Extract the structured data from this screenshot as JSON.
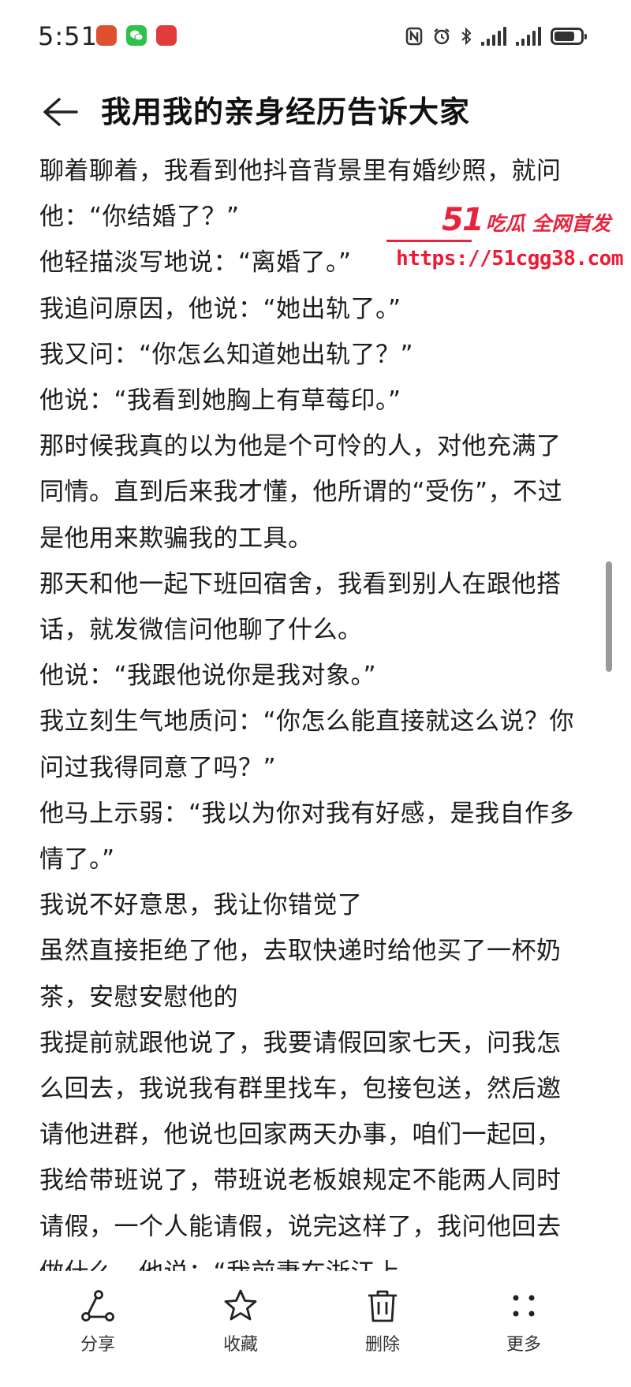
{
  "status_bar": {
    "time": "5:51",
    "apps": [
      {
        "name": "app-icon-1",
        "label": "",
        "color": "#e0502f"
      },
      {
        "name": "wechat-icon",
        "label": "",
        "color": "#2dc24a"
      },
      {
        "name": "app-icon-3",
        "label": "",
        "color": "#e23b3b"
      }
    ],
    "battery_level": 0.7
  },
  "header": {
    "title": "我用我的亲身经历告诉大家"
  },
  "watermark": {
    "number": "51",
    "text": "吃瓜 全网首发",
    "url": "https://51cgg38.com"
  },
  "article": {
    "paragraphs": [
      "聊着聊着，我看到他抖音背景里有婚纱照，就问他：“你结婚了？”",
      "他轻描淡写地说：“离婚了。”",
      "我追问原因，他说：“她出轨了。”",
      "我又问：“你怎么知道她出轨了？”",
      "他说：“我看到她胸上有草莓印。”",
      "那时候我真的以为他是个可怜的人，对他充满了同情。直到后来我才懂，他所谓的“受伤”，不过是他用来欺骗我的工具。",
      "那天和他一起下班回宿舍，我看到别人在跟他搭话，就发微信问他聊了什么。",
      "他说：“我跟他说你是我对象。”",
      "我立刻生气地质问：“你怎么能直接就这么说？你问过我得同意了吗？”",
      "他马上示弱：“我以为你对我有好感，是我自作多情了。”",
      "我说不好意思，我让你错觉了",
      "虽然直接拒绝了他，去取快递时给他买了一杯奶茶，安慰安慰他的",
      "我提前就跟他说了，我要请假回家七天，问我怎么回去，我说我有群里找车，包接包送，然后邀请他进群，他说也回家两天办事，咱们一起回，我给带班说了，带班说老板娘规定不能两人同时请假，一个人能请假，说完这样了，我问他回去做什么，他说：“我前妻在浙江上"
    ]
  },
  "bottom_bar": {
    "share": "分享",
    "favorite": "收藏",
    "delete": "删除",
    "more": "更多"
  }
}
